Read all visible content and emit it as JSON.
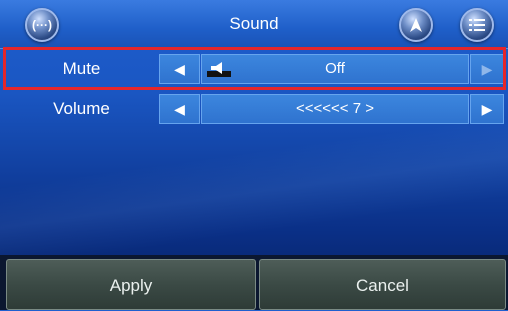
{
  "header": {
    "title": "Sound",
    "left_button_icon": "more-icon",
    "nav_button_icon": "navigation-arrow-icon",
    "menu_button_icon": "list-menu-icon"
  },
  "rows": [
    {
      "label": "Mute",
      "left_arrow": "◀",
      "value": "Off",
      "right_arrow": "▶",
      "value_icon": "speaker-icon"
    },
    {
      "label": "Volume",
      "left_arrow": "◀",
      "value": "<<<<<< 7 >",
      "right_arrow": "▶"
    }
  ],
  "footer": {
    "apply_label": "Apply",
    "cancel_label": "Cancel"
  },
  "colors": {
    "highlight": "#e5262a",
    "background": "#1a56c2"
  }
}
